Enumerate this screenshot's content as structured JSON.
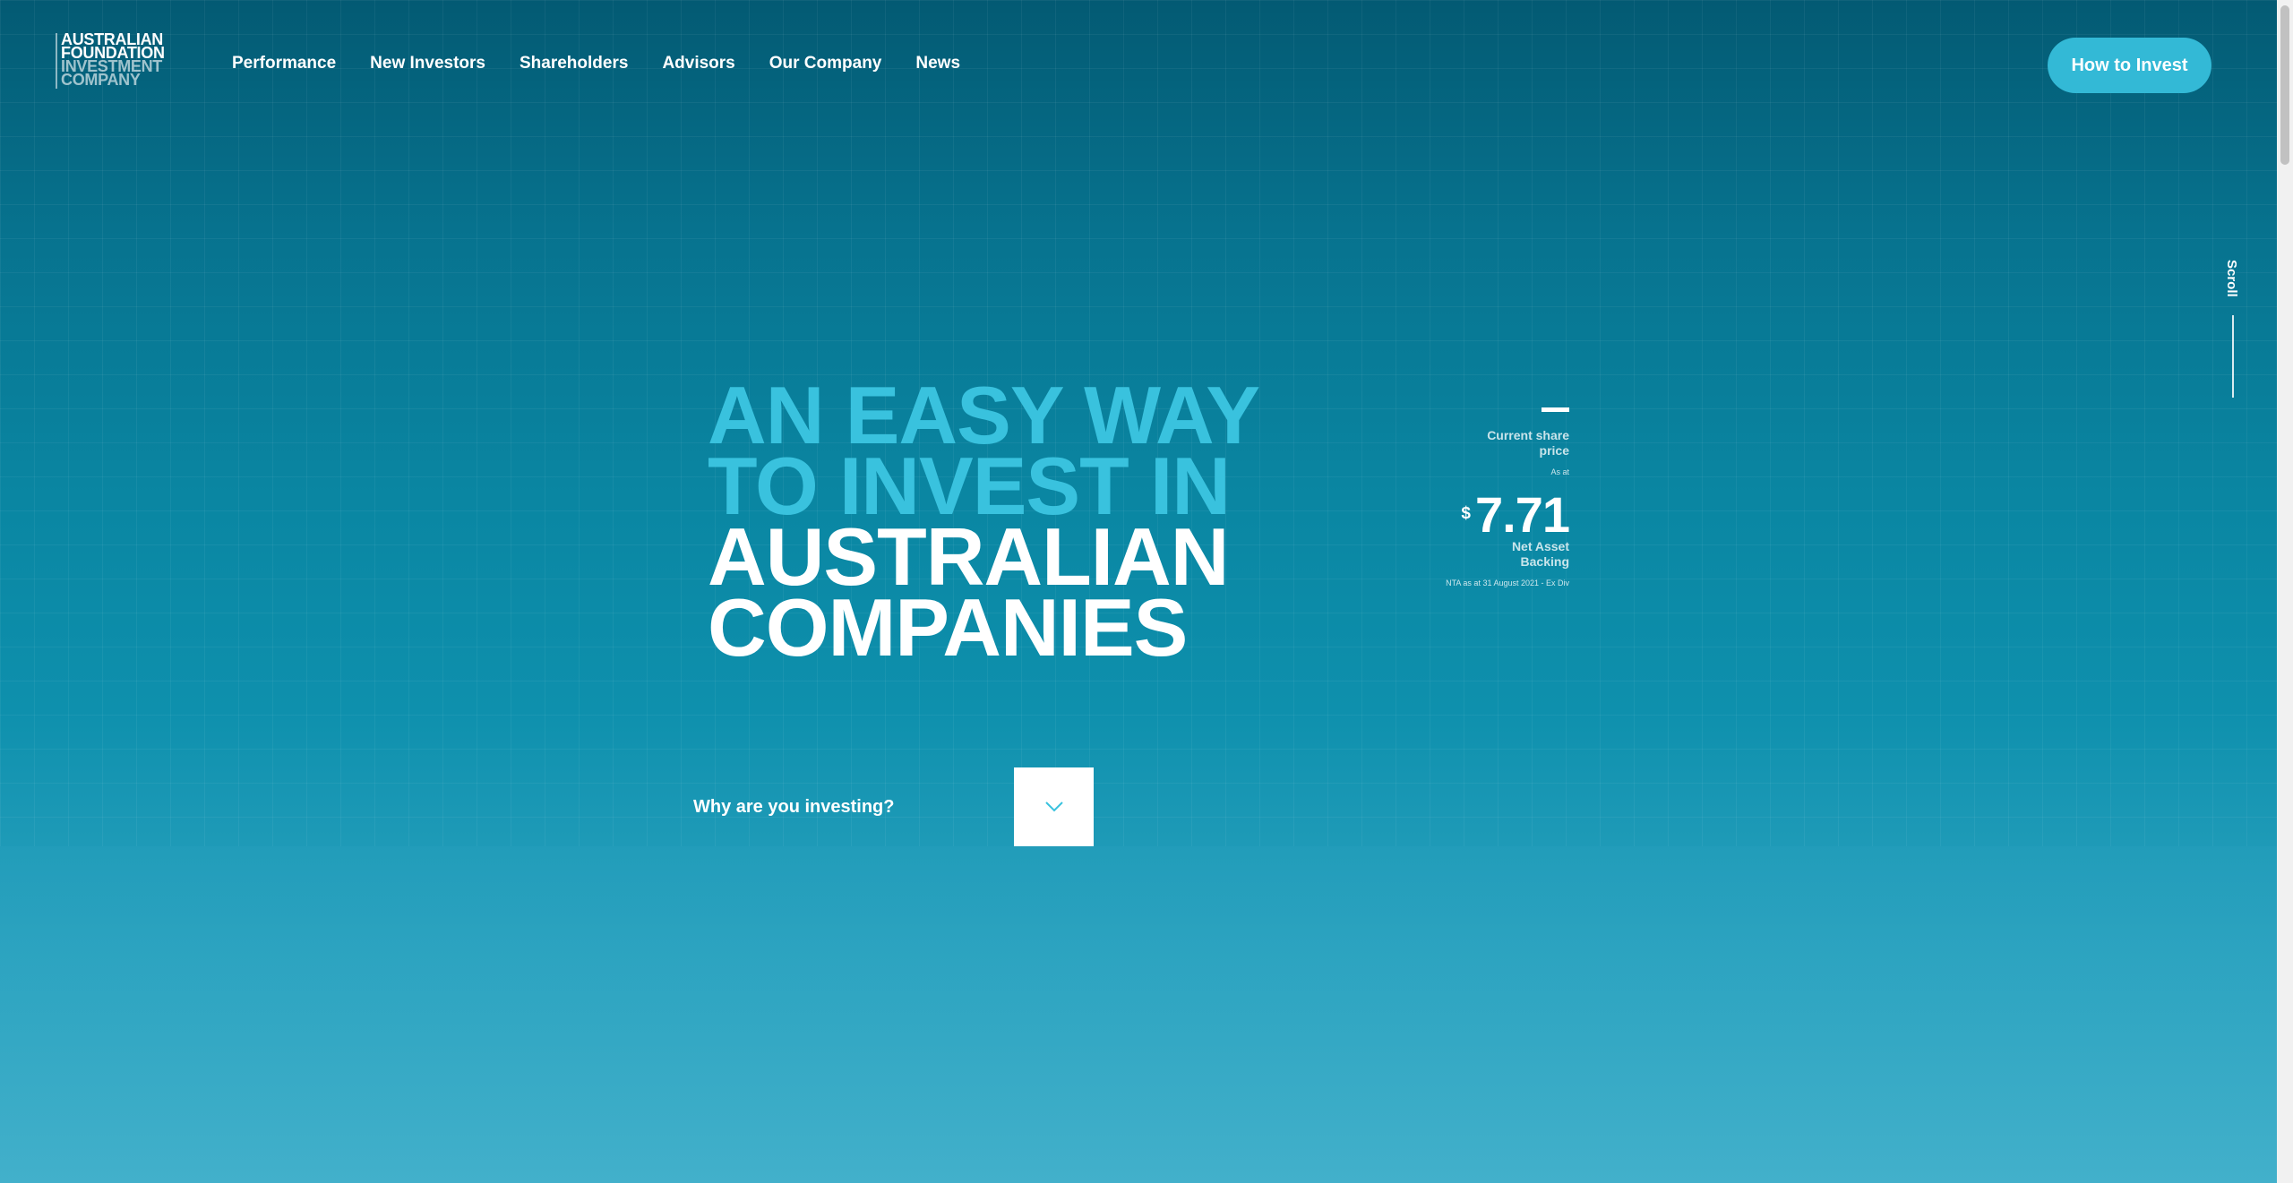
{
  "logo": {
    "line1": "AUSTRALIAN",
    "line2": "FOUNDATION",
    "line3": "INVESTMENT",
    "line4": "COMPANY"
  },
  "nav": {
    "items": [
      {
        "label": "Performance"
      },
      {
        "label": "New Investors"
      },
      {
        "label": "Shareholders"
      },
      {
        "label": "Advisors"
      },
      {
        "label": "Our Company"
      },
      {
        "label": "News"
      }
    ]
  },
  "header": {
    "cta_label": "How to Invest"
  },
  "scroll": {
    "label": "Scroll"
  },
  "hero": {
    "line1": "AN EASY WAY",
    "line2": "TO INVEST IN",
    "line3": "AUSTRALIAN",
    "line4": "COMPANIES"
  },
  "share_price": {
    "label": "Current share price",
    "as_at": "As at",
    "currency": "$",
    "value": "7.71",
    "nta_label": "Net Asset Backing",
    "note": "NTA as at 31 August 2021 - Ex Div"
  },
  "investing": {
    "label": "Why are you investing?"
  },
  "colors": {
    "accent": "#39c2de",
    "cta": "#33b9d6",
    "background_top": "#035a73",
    "background_bottom": "#41afca"
  },
  "icons": {
    "toggle": "chevron-down-icon"
  }
}
